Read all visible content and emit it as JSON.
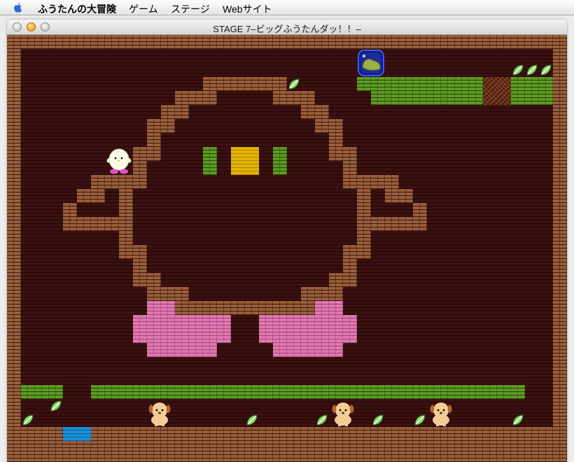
{
  "menubar": {
    "apple_icon": "apple-icon",
    "items": [
      "ふうたんの大冒険",
      "ゲーム",
      "ステージ",
      "Webサイト"
    ]
  },
  "window": {
    "title": "STAGE 7–ビッグふうたんダッ！！–"
  },
  "colors": {
    "brick": "#9a5e3a",
    "grass": "#5e9a22",
    "pink": "#de78b0",
    "yellow": "#e2b400",
    "water": "#1a8ed6",
    "background": "#2a0b0b"
  },
  "game": {
    "player": "futan-egg-character",
    "enemy": "puppy-enemy",
    "enemy_count": 3,
    "collectible": "green-leaf",
    "leaf_count": 12,
    "goal_item": "goal-bottle-icon"
  }
}
